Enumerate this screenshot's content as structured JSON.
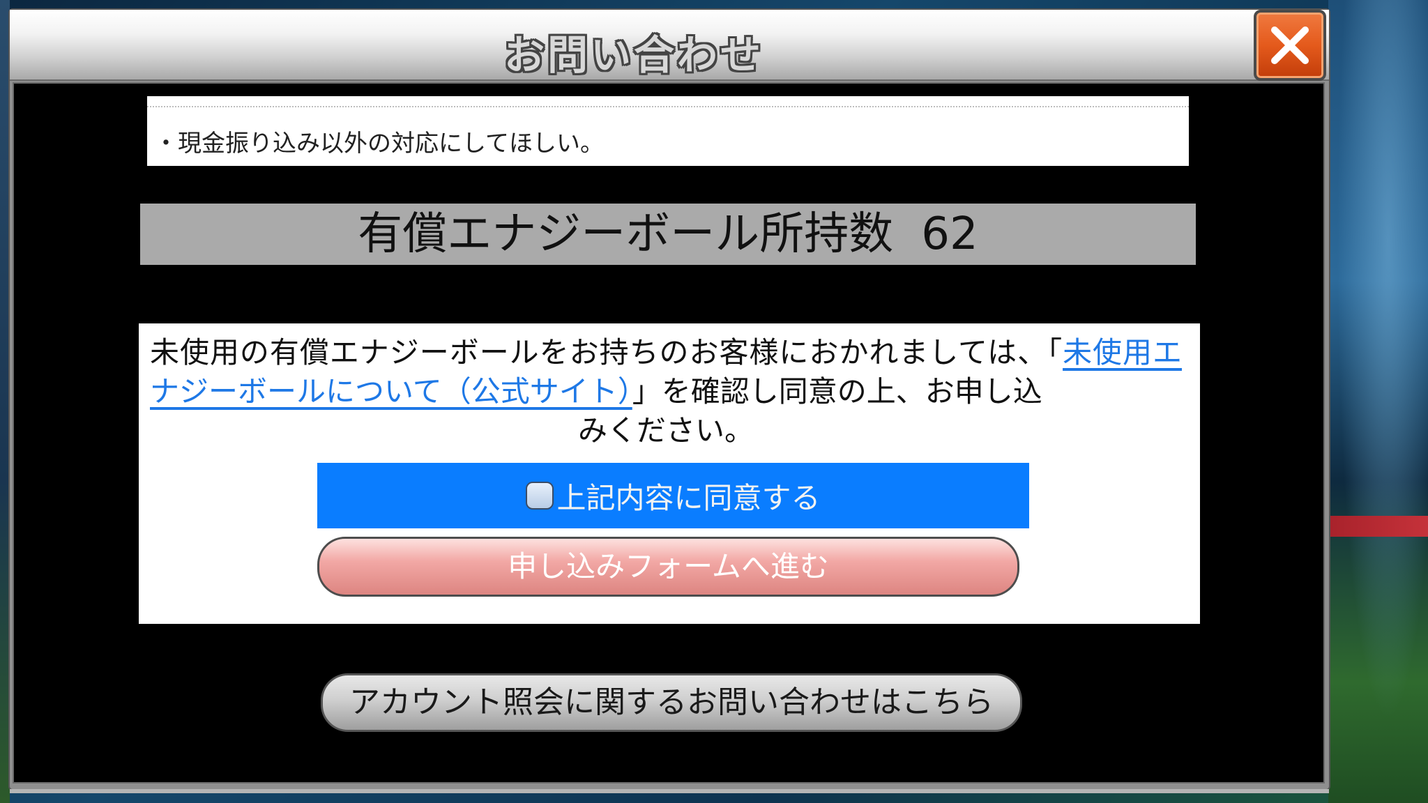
{
  "dialog": {
    "title": "お問い合わせ"
  },
  "notice": {
    "text": "・現金振り込み以外の対応にしてほしい。"
  },
  "energy": {
    "label": "有償エナジーボール所持数",
    "count": "62"
  },
  "consent": {
    "text_before": "未使用の有償エナジーボールをお持ちのお客様におかれましては、「",
    "link_text": "未使用エナジーボールについて（公式サイト）",
    "text_after_line2": "」を確認し同意の上、お申し込",
    "text_last_line": "みください。",
    "agree_label": "上記内容に同意する",
    "agree_checked": false,
    "proceed_label": "申し込みフォームへ進む"
  },
  "account_button": {
    "label": "アカウント照会に関するお問い合わせはこちら"
  },
  "colors": {
    "agree_bar": "#0a7dff",
    "link": "#1e78e6",
    "close_button": "#e45a1c",
    "proceed_button": "#f2a8a5"
  }
}
